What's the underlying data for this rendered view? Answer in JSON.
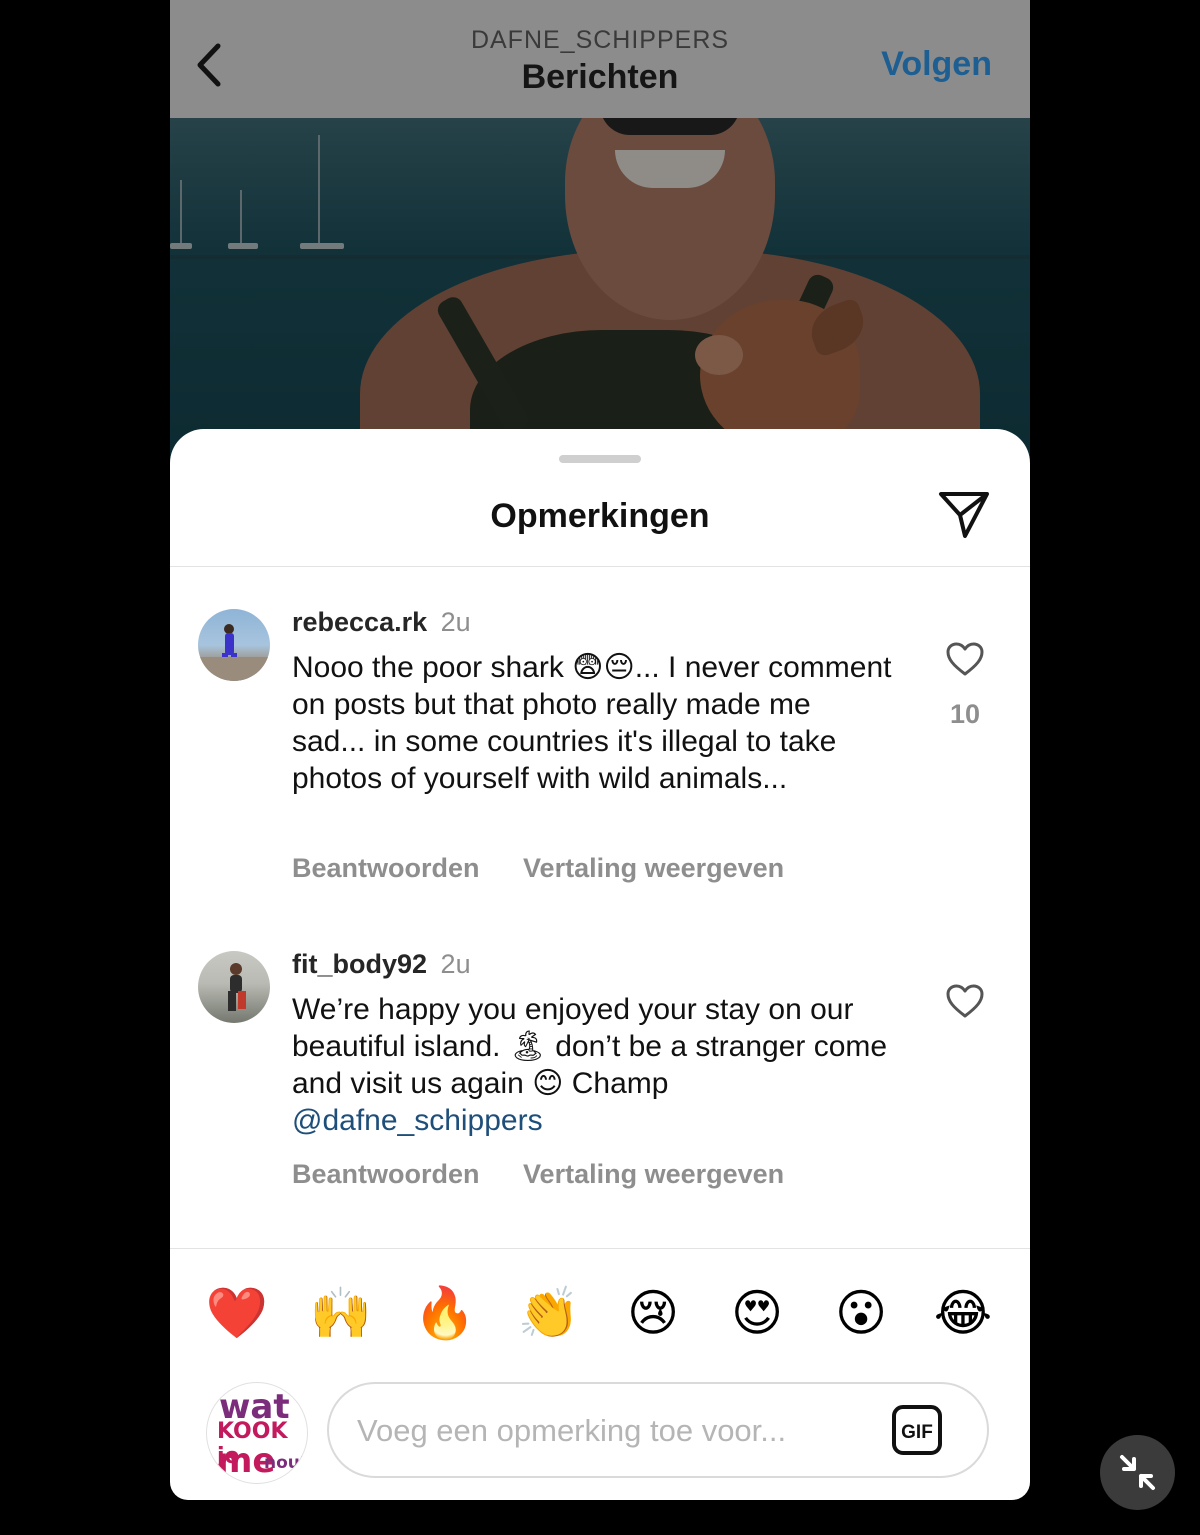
{
  "header": {
    "overline": "DAFNE_SCHIPPERS",
    "title": "Berichten",
    "follow_label": "Volgen"
  },
  "sheet": {
    "title": "Opmerkingen"
  },
  "comments": [
    {
      "username": "rebecca.rk",
      "time": "2u",
      "text": "Nooo the poor shark 😨😔... I never comment on posts but that photo really made me sad... in some countries it's illegal to take photos of yourself with wild animals...",
      "likes": "10",
      "reply_label": "Beantwoorden",
      "translate_label": "Vertaling weergeven"
    },
    {
      "username": "fit_body92",
      "time": "2u",
      "text_before_mention": "We’re happy you enjoyed your stay on our beautiful island. 🏝 don’t be a stranger come and visit us again 😊 Champ ",
      "mention": "@dafne_schippers",
      "reply_label": "Beantwoorden",
      "translate_label": "Vertaling weergeven"
    }
  ],
  "quick_emojis": [
    "❤️",
    "🙌",
    "🔥",
    "👏",
    "😢",
    "😍",
    "😮",
    "😂"
  ],
  "composer": {
    "placeholder": "Voeg een opmerking toe voor...",
    "gif_label": "GIF",
    "avatar_logo": [
      "wat",
      "KOOK je",
      "me",
      "nou?"
    ]
  },
  "colors": {
    "accent": "#1d5f92",
    "mention": "#1e4e7a",
    "secondary_text": "#8e8e8e"
  }
}
